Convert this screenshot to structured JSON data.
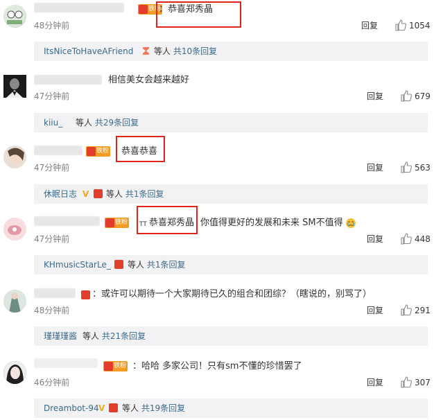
{
  "comments": [
    {
      "text": "：恭喜郑秀晶",
      "badge": "铁粉",
      "time": "48分钟前",
      "reply": "回复",
      "likes": "1054",
      "sub": {
        "name": "ItsNiceToHaveAFriend",
        "rest": "等人",
        "count": "共10条回复"
      }
    },
    {
      "text": "相信美女会越来越好",
      "time": "47分钟前",
      "reply": "回复",
      "likes": "679",
      "sub": {
        "name": "kiiu_",
        "rest": "等人",
        "count": "共29条回复"
      }
    },
    {
      "text": "恭喜恭喜",
      "badge": "铁粉",
      "time": "47分钟前",
      "reply": "回复",
      "likes": "563",
      "sub": {
        "name": "休眠日志",
        "vip": "V",
        "rest": "等人",
        "count": "共1条回复"
      }
    },
    {
      "prefix": "TT",
      "text": "恭喜郑秀晶",
      "text2": "你值得更好的发展和未来 SM不值得",
      "badge": "铁粉",
      "time": "47分钟前",
      "reply": "回复",
      "likes": "448",
      "sub": {
        "name": "KHmusicStarLe_",
        "rest": "等人",
        "count": "共1条回复"
      }
    },
    {
      "text": "：或许可以期待一个大家期待已久的组合和团综？（瞎说的，别骂了）",
      "time": "48分钟前",
      "reply": "回复",
      "likes": "291",
      "sub": {
        "name": "瑾瑾瑾酱",
        "rest": "等人",
        "count": "共21条回复"
      }
    },
    {
      "text": "：哈哈 多家公司！只有sm不懂的珍惜罢了",
      "badge": "铁粉",
      "time": "46分钟前",
      "reply": "回复",
      "likes": "307",
      "sub": {
        "name": "Dreambot-94",
        "vip": "V",
        "rest": "等人",
        "count": "共19条回复"
      }
    }
  ],
  "colors": {
    "highlight": "#e1231a",
    "link": "#3a6b8c",
    "badge": "#f39c23",
    "subbg": "#f2f2f5"
  }
}
